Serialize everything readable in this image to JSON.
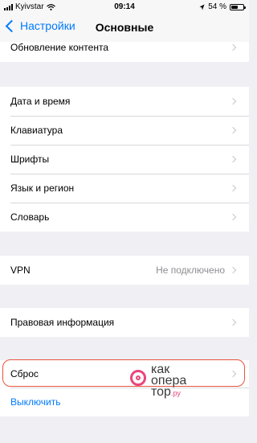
{
  "status_bar": {
    "carrier": "Kyivstar",
    "time": "09:14",
    "battery_percent": "54 %",
    "battery_level": 0.54
  },
  "nav": {
    "back_label": "Настройки",
    "title": "Основные"
  },
  "groups": [
    {
      "items": [
        {
          "label": "Обновление контента"
        }
      ]
    },
    {
      "items": [
        {
          "label": "Дата и время"
        },
        {
          "label": "Клавиатура"
        },
        {
          "label": "Шрифты"
        },
        {
          "label": "Язык и регион"
        },
        {
          "label": "Словарь"
        }
      ]
    },
    {
      "items": [
        {
          "label": "VPN",
          "value": "Не подключено"
        }
      ]
    },
    {
      "items": [
        {
          "label": "Правовая информация"
        }
      ]
    },
    {
      "items": [
        {
          "label": "Сброс"
        },
        {
          "label": "Выключить"
        }
      ]
    }
  ],
  "watermark": {
    "line1": "как",
    "line2": "опера",
    "line3": "тор",
    "suffix": ".ру"
  },
  "colors": {
    "accent": "#007aff",
    "highlight": "#e9533f",
    "background": "#efeff4"
  }
}
